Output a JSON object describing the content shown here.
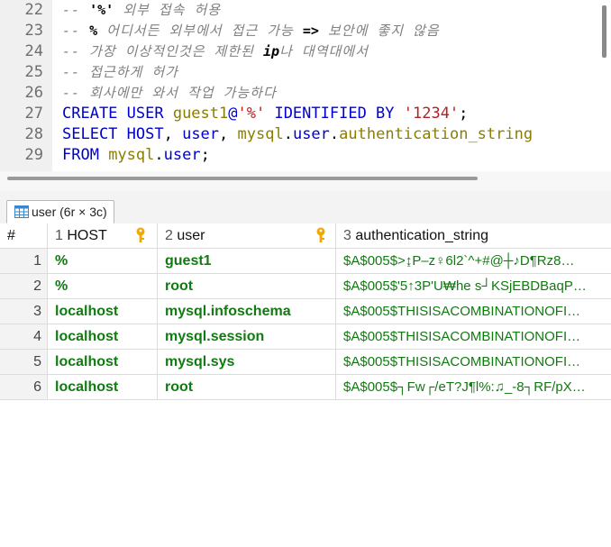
{
  "editor": {
    "lines": [
      {
        "num": "22",
        "segs": [
          [
            "cm",
            "-- "
          ],
          [
            "cmb",
            "'%'"
          ],
          [
            "cm",
            " 외부 접속 허용"
          ]
        ]
      },
      {
        "num": "23",
        "segs": [
          [
            "cm",
            "-- "
          ],
          [
            "cmb",
            "%"
          ],
          [
            "cm",
            " 어디서든 외부에서 접근 가능 "
          ],
          [
            "cmb",
            "=>"
          ],
          [
            "cm",
            " 보안에 좋지 않음"
          ]
        ]
      },
      {
        "num": "24",
        "segs": [
          [
            "cm",
            "-- 가장 이상적인것은 제한된 "
          ],
          [
            "cmb",
            "ip"
          ],
          [
            "cm",
            "나 대역대에서"
          ]
        ]
      },
      {
        "num": "25",
        "segs": [
          [
            "cm",
            "-- 접근하게 허가"
          ]
        ]
      },
      {
        "num": "26",
        "segs": [
          [
            "cm",
            "-- 회사에만 와서 작업 가능하다"
          ]
        ]
      },
      {
        "num": "27",
        "segs": [
          [
            "kw",
            "CREATE USER "
          ],
          [
            "obj",
            "guest1"
          ],
          [
            "kw",
            "@"
          ],
          [
            "str",
            "'%'"
          ],
          [
            "kw",
            " IDENTIFIED BY "
          ],
          [
            "str",
            "'1234'"
          ],
          [
            "pl",
            ";"
          ]
        ]
      },
      {
        "num": "28",
        "segs": [
          [
            "kw",
            "SELECT HOST"
          ],
          [
            "pl",
            ", "
          ],
          [
            "kw",
            "user"
          ],
          [
            "pl",
            ", "
          ],
          [
            "obj",
            "mysql"
          ],
          [
            "pl",
            "."
          ],
          [
            "kw",
            "user"
          ],
          [
            "pl",
            "."
          ],
          [
            "obj",
            "authentication_string"
          ]
        ]
      },
      {
        "num": "29",
        "segs": [
          [
            "kw",
            "FROM "
          ],
          [
            "obj",
            "mysql"
          ],
          [
            "pl",
            "."
          ],
          [
            "kw",
            "user"
          ],
          [
            "pl",
            ";"
          ]
        ]
      }
    ]
  },
  "result_tab": {
    "label": "user (6r × 3c)",
    "icon": "table-grid-icon"
  },
  "grid": {
    "row_header": "#",
    "columns": [
      {
        "index": "1",
        "name": "HOST",
        "key_icon": "key-icon"
      },
      {
        "index": "2",
        "name": "user",
        "key_icon": "key-icon"
      },
      {
        "index": "3",
        "name": "authentication_string"
      }
    ],
    "rows": [
      {
        "n": "1",
        "host": "%",
        "user": "guest1",
        "auth": "$A$005$>↨P–z♀6l2`^+#@┼♪D¶Rz8…"
      },
      {
        "n": "2",
        "host": "%",
        "user": "root",
        "auth": "$A$005$'5↑3P'U₩he s┘KSjEBDBaqP…"
      },
      {
        "n": "3",
        "host": "localhost",
        "user": "mysql.infoschema",
        "auth": "$A$005$THISISACOMBINATIONOFI…"
      },
      {
        "n": "4",
        "host": "localhost",
        "user": "mysql.session",
        "auth": "$A$005$THISISACOMBINATIONOFI…"
      },
      {
        "n": "5",
        "host": "localhost",
        "user": "mysql.sys",
        "auth": "$A$005$THISISACOMBINATIONOFI…"
      },
      {
        "n": "6",
        "host": "localhost",
        "user": "root",
        "auth": "$A$005$┐Fw┌/eT?J¶l%:♫_-8┐RF/pX…"
      }
    ]
  },
  "colors": {
    "keyword": "#0000cc",
    "identifier": "#8b7d00",
    "string": "#b22222",
    "comment": "#808080",
    "grid_text": "#117a11",
    "key_icon": "#f0a800"
  }
}
